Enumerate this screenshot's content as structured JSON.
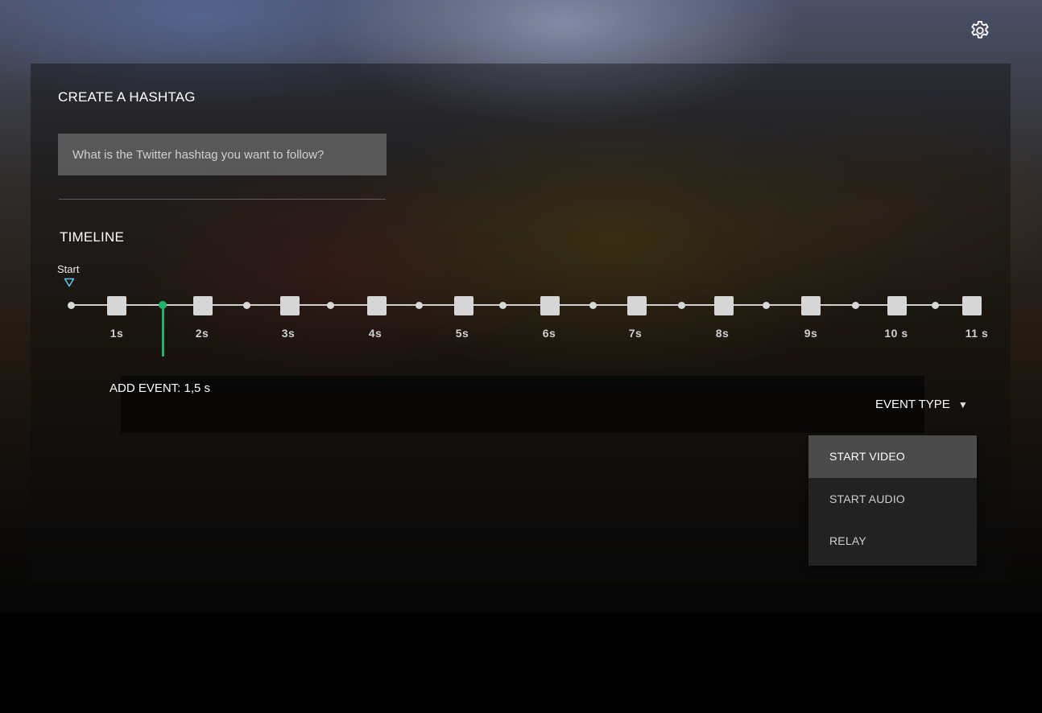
{
  "hashtag": {
    "title": "CREATE A HASHTAG",
    "input_placeholder": "What is the Twitter hashtag you want to follow?",
    "input_value": ""
  },
  "timeline": {
    "title": "TIMELINE",
    "start_label": "Start",
    "ticks": [
      "1s",
      "2s",
      "3s",
      "4s",
      "5s",
      "6s",
      "7s",
      "8s",
      "9s",
      "10 s",
      "11 s"
    ],
    "cursor_seconds": 1.5
  },
  "event": {
    "add_label": "ADD EVENT: 1,5 s",
    "type_label": "EVENT TYPE",
    "caret": "▼",
    "options": [
      "START VIDEO",
      "START AUDIO",
      "RELAY"
    ],
    "selected_index": 0
  },
  "colors": {
    "accent": "#1fb36a",
    "start_marker": "#5fc4e8"
  }
}
